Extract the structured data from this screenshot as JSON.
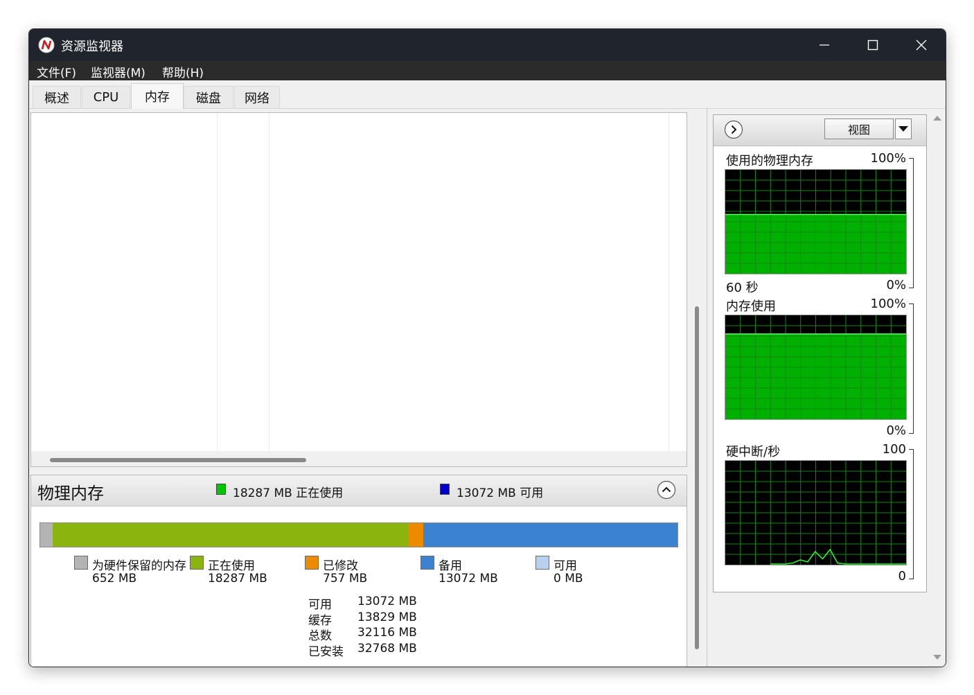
{
  "window": {
    "title": "资源监视器"
  },
  "menu": [
    "文件(F)",
    "监视器(M)",
    "帮助(H)"
  ],
  "tabs": [
    "概述",
    "CPU",
    "内存",
    "磁盘",
    "网络"
  ],
  "active_tab": "内存",
  "physical_memory": {
    "title": "物理内存",
    "header_in_use": "18287 MB 正在使用",
    "header_available": "13072 MB 可用",
    "colors": {
      "reserved": "#b4b4b4",
      "in_use": "#8cb40e",
      "modified": "#ee8a00",
      "standby": "#3c82d2",
      "free": "#b8d2ee",
      "in_use_header": "#00c800",
      "available_header": "#0000c8"
    },
    "segments_mb": {
      "reserved": 652,
      "in_use": 18287,
      "modified": 757,
      "standby": 13072,
      "free": 0
    },
    "legend": [
      {
        "key": "reserved",
        "label": "为硬件保留的内存",
        "value": "652 MB"
      },
      {
        "key": "in_use",
        "label": "正在使用",
        "value": "18287 MB"
      },
      {
        "key": "modified",
        "label": "已修改",
        "value": "757 MB"
      },
      {
        "key": "standby",
        "label": "备用",
        "value": "13072 MB"
      },
      {
        "key": "free",
        "label": "可用",
        "value": "0 MB"
      }
    ],
    "summary": [
      {
        "label": "可用",
        "value": "13072 MB"
      },
      {
        "label": "缓存",
        "value": "13829 MB"
      },
      {
        "label": "总数",
        "value": "32116 MB"
      },
      {
        "label": "已安装",
        "value": "32768 MB"
      }
    ]
  },
  "graphs_panel": {
    "view_button": "视图",
    "graphs": [
      {
        "title": "使用的物理内存",
        "top": "100%",
        "bottom_left": "60 秒",
        "bottom_right": "0%",
        "level_percent": 57
      },
      {
        "title": "内存使用",
        "top": "100%",
        "bottom_left": "",
        "bottom_right": "0%",
        "level_percent": 82
      },
      {
        "title": "硬中断/秒",
        "top": "100",
        "bottom_left": "",
        "bottom_right": "0",
        "spikes": [
          0,
          0,
          0,
          1,
          4,
          2,
          12,
          5,
          14,
          1,
          0,
          0,
          0
        ]
      }
    ]
  }
}
